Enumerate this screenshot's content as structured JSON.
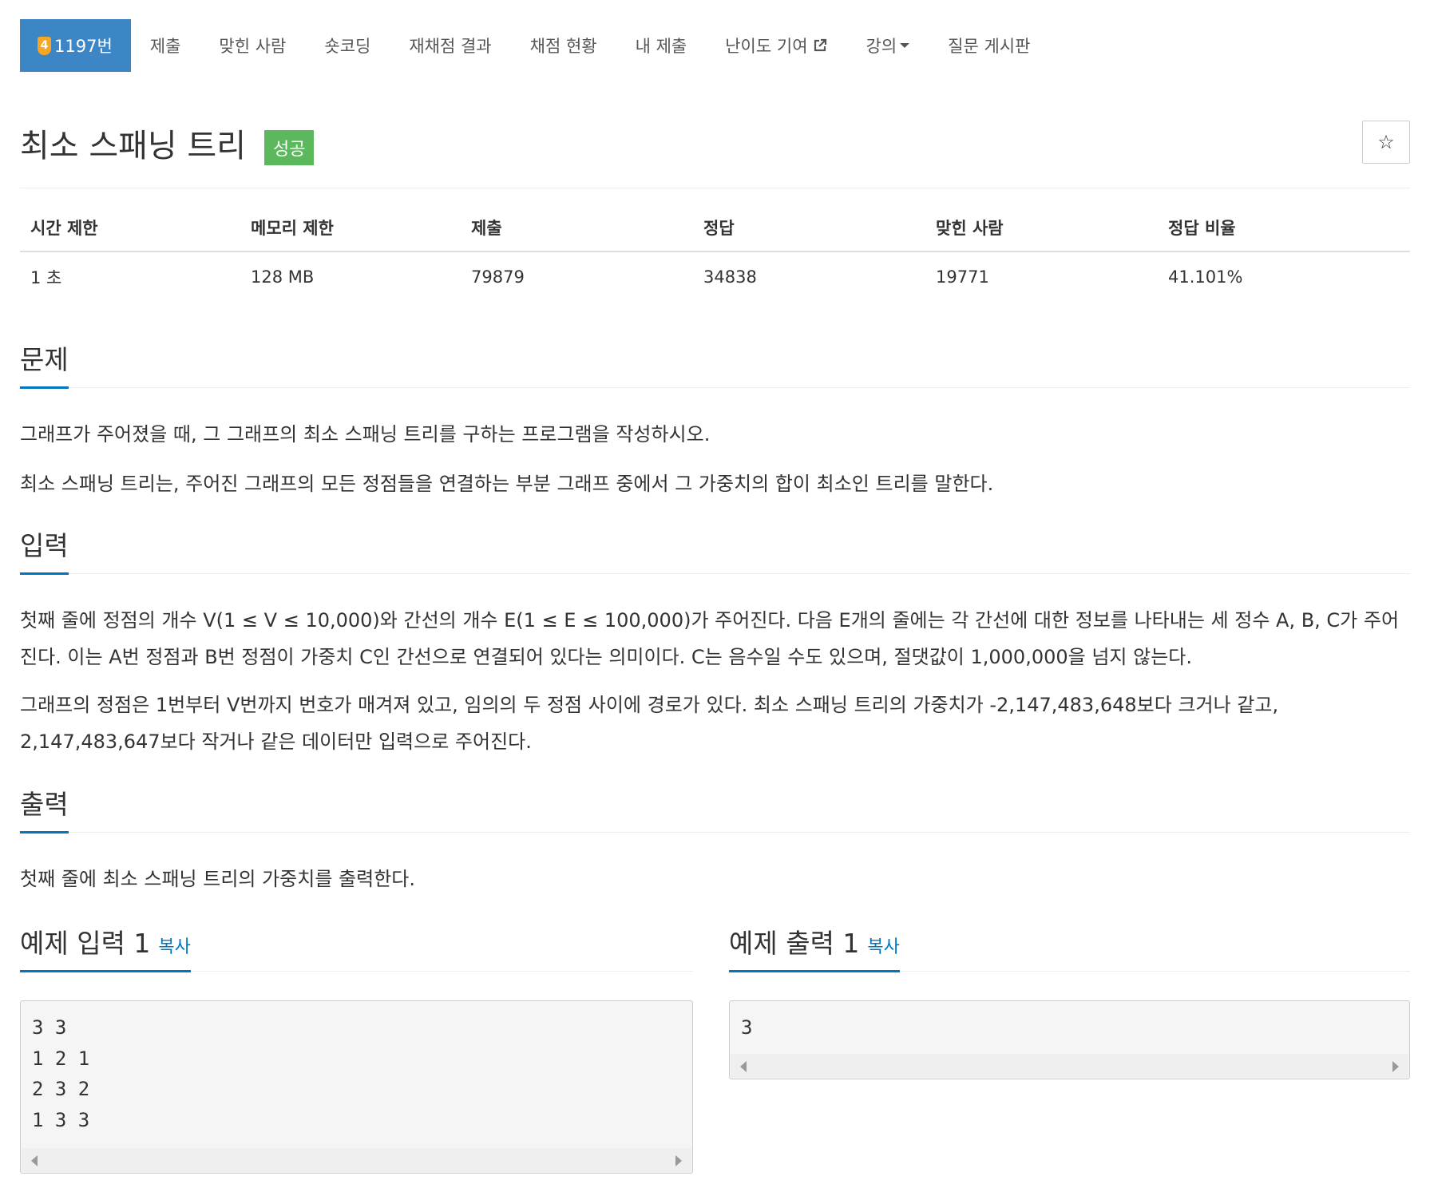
{
  "nav": {
    "problem_tier": "4",
    "problem_number": "1197번",
    "items": [
      "제출",
      "맞힌 사람",
      "숏코딩",
      "재채점 결과",
      "채점 현황",
      "내 제출",
      "난이도 기여",
      "강의",
      "질문 게시판"
    ]
  },
  "problem": {
    "title": "최소 스패닝 트리",
    "status_badge": "성공",
    "favorite_icon": "☆",
    "colors": {
      "accent": "#3d86c6",
      "success": "#5cb85c",
      "link": "#0076c0",
      "tier": "#f6a623"
    }
  },
  "stats": {
    "headers": [
      "시간 제한",
      "메모리 제한",
      "제출",
      "정답",
      "맞힌 사람",
      "정답 비율"
    ],
    "values": [
      "1 초",
      "128 MB",
      "79879",
      "34838",
      "19771",
      "41.101%"
    ]
  },
  "sections": {
    "problem": {
      "heading": "문제",
      "paragraphs": [
        "그래프가 주어졌을 때, 그 그래프의 최소 스패닝 트리를 구하는 프로그램을 작성하시오.",
        "최소 스패닝 트리는, 주어진 그래프의 모든 정점들을 연결하는 부분 그래프 중에서 그 가중치의 합이 최소인 트리를 말한다."
      ]
    },
    "input": {
      "heading": "입력",
      "paragraphs": [
        "첫째 줄에 정점의 개수 V(1 ≤ V ≤ 10,000)와 간선의 개수 E(1 ≤ E ≤ 100,000)가 주어진다. 다음 E개의 줄에는 각 간선에 대한 정보를 나타내는 세 정수 A, B, C가 주어진다. 이는 A번 정점과 B번 정점이 가중치 C인 간선으로 연결되어 있다는 의미이다. C는 음수일 수도 있으며, 절댓값이 1,000,000을 넘지 않는다.",
        "그래프의 정점은 1번부터 V번까지 번호가 매겨져 있고, 임의의 두 정점 사이에 경로가 있다. 최소 스패닝 트리의 가중치가 -2,147,483,648보다 크거나 같고, 2,147,483,647보다 작거나 같은 데이터만 입력으로 주어진다."
      ]
    },
    "output": {
      "heading": "출력",
      "paragraphs": [
        "첫째 줄에 최소 스패닝 트리의 가중치를 출력한다."
      ]
    }
  },
  "samples": {
    "input": {
      "heading": "예제 입력 1",
      "copy_label": "복사",
      "text": "3 3\n1 2 1\n2 3 2\n1 3 3"
    },
    "output": {
      "heading": "예제 출력 1",
      "copy_label": "복사",
      "text": "3"
    }
  }
}
